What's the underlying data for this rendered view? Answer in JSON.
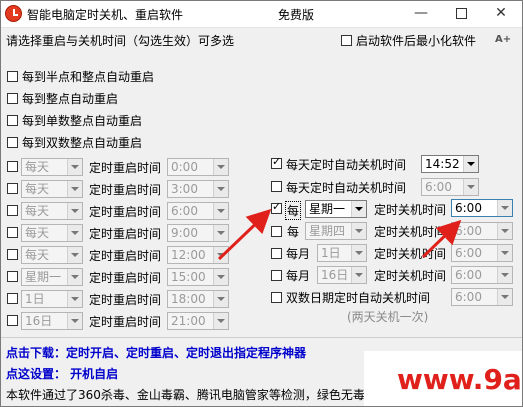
{
  "window": {
    "title": "智能电脑定时关机、重启软件",
    "edition": "免费版",
    "controls": {
      "minimize": "—",
      "close": "✕"
    }
  },
  "header": {
    "instruction": "请选择重启与关机时间（勾选生效）可多选",
    "start_minimized_label": "启动软件后最小化软件",
    "start_minimized_checked": false,
    "font_size_button": "A+"
  },
  "reboot_presets": [
    {
      "label": "每到半点和整点自动重启",
      "checked": false
    },
    {
      "label": "每到整点自动重启",
      "checked": false
    },
    {
      "label": "每到单数整点自动重启",
      "checked": false
    },
    {
      "label": "每到双数整点自动重启",
      "checked": false
    }
  ],
  "reboot_rows": [
    {
      "day": "每天",
      "label": "定时重启时间",
      "time": "0:00"
    },
    {
      "day": "每天",
      "label": "定时重启时间",
      "time": "3:00"
    },
    {
      "day": "每天",
      "label": "定时重启时间",
      "time": "6:00"
    },
    {
      "day": "每天",
      "label": "定时重启时间",
      "time": "9:00"
    },
    {
      "day": "每天",
      "label": "定时重启时间",
      "time": "12:00"
    },
    {
      "day": "星期一",
      "label": "定时重启时间",
      "time": "15:00"
    },
    {
      "day": "1日",
      "label": "定时重启时间",
      "time": "18:00"
    },
    {
      "day": "16日",
      "label": "定时重启时间",
      "time": "21:00"
    }
  ],
  "shutdown_rows": {
    "row1": {
      "label": "每天定时自动关机时间",
      "time": "14:52",
      "checked": true
    },
    "row2": {
      "label": "每天定时自动关机时间",
      "time": "6:00",
      "checked": false
    },
    "row3": {
      "prefix": "每",
      "day": "星期一",
      "label": "定时关机时间",
      "time": "6:00",
      "checked": true
    },
    "row4": {
      "prefix": "每",
      "day": "星期四",
      "label": "定时关机时间",
      "time": "6:00",
      "checked": false
    },
    "row5": {
      "prefix": "每月",
      "day": "1日",
      "label": "定时关机时间",
      "time": "6:00",
      "checked": false
    },
    "row6": {
      "prefix": "每月",
      "day": "16日",
      "label": "定时关机时间",
      "time": "6:00",
      "checked": false
    },
    "row7": {
      "label": "双数日期定时自动关机时间",
      "time": "6:00",
      "checked": false
    },
    "note": "(两天关机一次)"
  },
  "footer": {
    "download_text": "点击下载：定时开启、定时重启、定时退出指定程序神器",
    "settings_text": "点这设置： 开机自启",
    "info_text": "本软件通过了360杀毒、金山毒霸、腾讯电脑管家等检测，绿色无毒",
    "watermark": "www.9a9m.com"
  },
  "colors": {
    "link": "#0000cc",
    "watermark": "#e0201a",
    "annotation_arrow": "#e0201a"
  }
}
